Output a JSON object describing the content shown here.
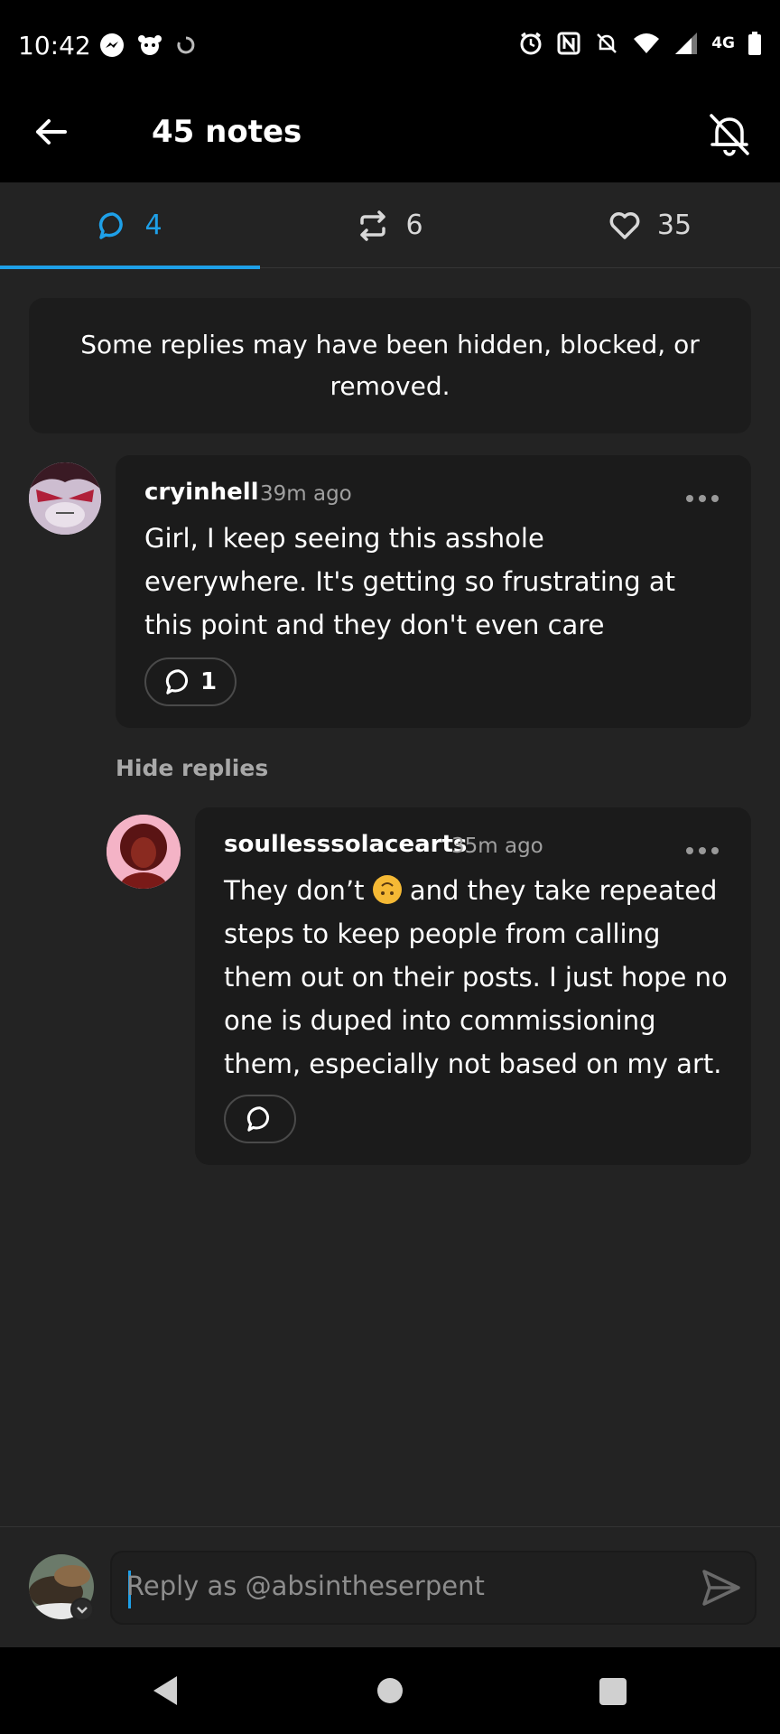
{
  "status_bar": {
    "time": "10:42",
    "network": "4G"
  },
  "app_bar": {
    "title": "45 notes"
  },
  "tabs": [
    {
      "icon": "comment-icon",
      "count": "4",
      "active": true
    },
    {
      "icon": "reblog-icon",
      "count": "6",
      "active": false
    },
    {
      "icon": "heart-icon",
      "count": "35",
      "active": false
    }
  ],
  "notice": "Some replies may have been hidden, blocked, or removed.",
  "comments": [
    {
      "username": "cryinhell",
      "time": "39m ago",
      "text": "Girl, I keep seeing this asshole everywhere. It's getting so frustrating at this point and they don't even care",
      "reply_count": "1"
    }
  ],
  "hide_replies_label": "Hide replies",
  "reply": {
    "username": "soullesssolacearts",
    "time": "35m ago",
    "text_before_emoji": "They don’t",
    "text_after_emoji": "and they take repeated steps to keep people from calling them out on their posts. I just hope no one is duped into commissioning them, especially not based on my art."
  },
  "composer": {
    "placeholder": "Reply as @absintheserpent"
  },
  "colors": {
    "accent": "#1ea0e8",
    "background": "#232323",
    "bubble": "#1b1b1b"
  }
}
